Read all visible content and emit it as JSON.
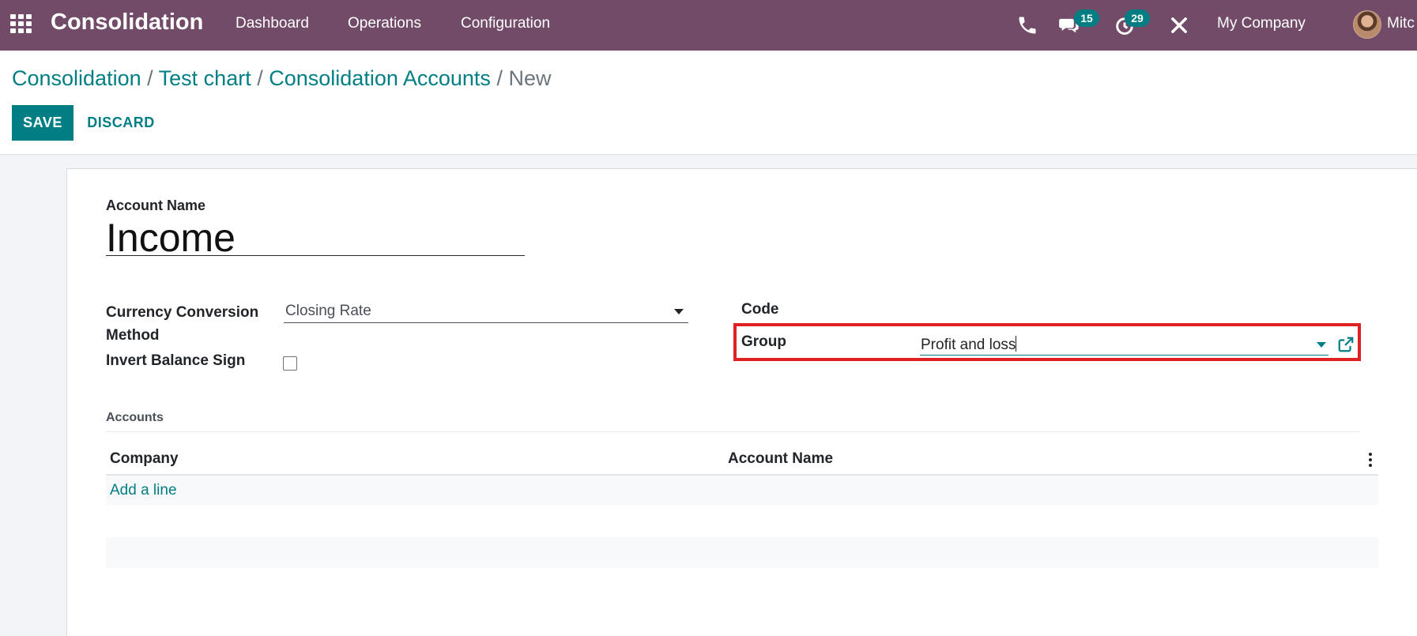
{
  "navbar": {
    "brand": "Consolidation",
    "menu": [
      "Dashboard",
      "Operations",
      "Configuration"
    ],
    "messages_count": "15",
    "activities_count": "29",
    "company": "My Company",
    "user": "Mitc"
  },
  "breadcrumb": {
    "items": [
      "Consolidation",
      "Test chart",
      "Consolidation Accounts"
    ],
    "separator": "/",
    "current": "New"
  },
  "buttons": {
    "save": "SAVE",
    "discard": "DISCARD"
  },
  "form": {
    "account_name_label": "Account Name",
    "account_name_value": "Income",
    "currency_method_label_line1": "Currency Conversion",
    "currency_method_label_line2": "Method",
    "currency_method_value": "Closing Rate",
    "invert_label": "Invert Balance Sign",
    "invert_checked": false,
    "code_label": "Code",
    "group_label": "Group",
    "group_value": "Profit and loss"
  },
  "accounts_section": {
    "title": "Accounts",
    "columns": [
      "Company",
      "Account Name"
    ],
    "add_line": "Add a line"
  },
  "colors": {
    "navbar": "#714b67",
    "accent": "#017e84",
    "highlight": "#e02124"
  }
}
